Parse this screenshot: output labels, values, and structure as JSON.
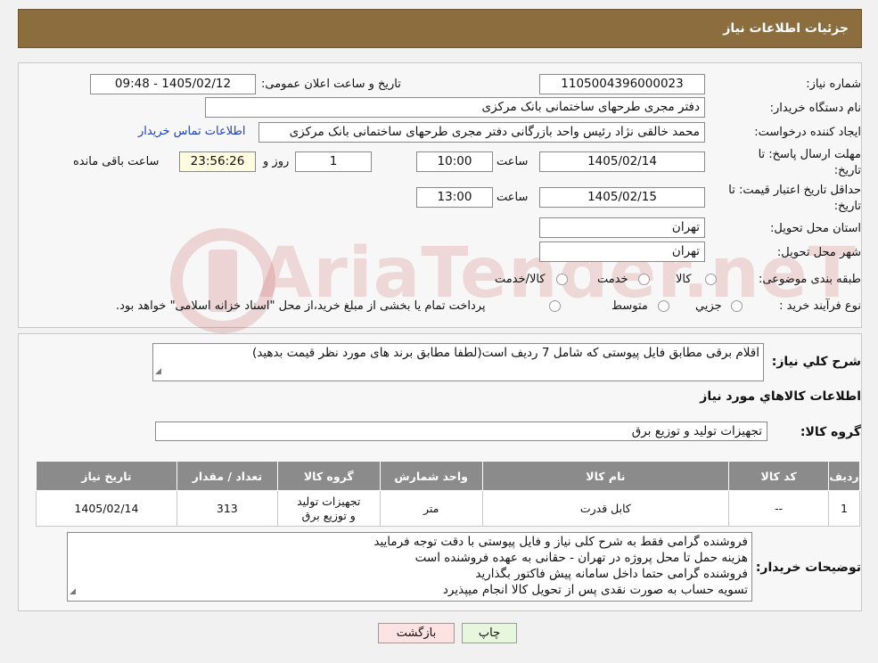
{
  "header": {
    "title": "جزئیات اطلاعات نیاز"
  },
  "watermark": {
    "text": "AriaTender.neT"
  },
  "fields": {
    "need_number_label": "شماره نیاز:",
    "need_number": "1105004396000023",
    "announce_label": "تاریخ و ساعت اعلان عمومی:",
    "announce_value": "1405/02/12 - 09:48",
    "buyer_org_label": "نام دستگاه خریدار:",
    "buyer_org": "دفتر مجری طرحهای ساختمانی بانک مرکزی",
    "requester_label": "ایجاد کننده درخواست:",
    "requester": "محمد خالقی نژاد رئیس واحد بازرگانی دفتر مجری طرحهای ساختمانی بانک مرکزی",
    "contact_link": "اطلاعات تماس خریدار",
    "deadline_label_1": "مهلت ارسال پاسخ: تا",
    "deadline_label_2": "تاریخ:",
    "deadline_date": "1405/02/14",
    "time_label": "ساعت",
    "deadline_time": "10:00",
    "days_value": "1",
    "days_label": "روز و",
    "remaining_value": "23:56:26",
    "remaining_label": "ساعت باقی مانده",
    "validity_label_1": "حداقل تاریخ اعتبار قیمت: تا",
    "validity_label_2": "تاریخ:",
    "validity_date": "1405/02/15",
    "validity_time": "13:00",
    "province_label": "استان محل تحویل:",
    "province": "تهران",
    "city_label": "شهر محل تحویل:",
    "city": "تهران",
    "category_label": "طبقه بندی موضوعی:",
    "category_options": [
      "کالا",
      "خدمت",
      "کالا/خدمت"
    ],
    "process_label": "نوع فرآیند خرید :",
    "process_options": [
      "جزیي",
      "متوسط"
    ],
    "process_note": "پرداخت تمام یا بخشی از مبلغ خرید،از محل \"اسناد خزانه اسلامی\" خواهد بود."
  },
  "description": {
    "label": "شرح کلي نياز:",
    "text": "اقلام برقی مطابق فایل پیوستی که شامل 7 ردیف است(لطفا مطابق برند های مورد نظر قیمت بدهید)"
  },
  "goods_info_title": "اطلاعات کالاهاي مورد نياز",
  "goods_group": {
    "label": "گروه کالا:",
    "value": "تجهیزات تولید و توزیع برق"
  },
  "table": {
    "headers": [
      "رديف",
      "کد کالا",
      "نام کالا",
      "واحد شمارش",
      "گروه کالا",
      "تعداد / مقدار",
      "تاريخ نياز"
    ],
    "rows": [
      [
        "1",
        "--",
        "کابل قدرت",
        "متر",
        "تجهیزات تولید و توزیع برق",
        "313",
        "1405/02/14"
      ]
    ]
  },
  "buyer_notes": {
    "label": "توضيحات خريدار:",
    "lines": [
      "فروشنده گرامی فقط به شرح کلی نیاز و فایل پیوستی با دقت توجه فرمایید",
      "هزینه حمل تا محل پروژه در تهران - حقانی به عهده فروشنده است",
      "فروشنده گرامی حتما داخل سامانه پیش فاکتور بگذارید",
      "تسویه حساب به صورت نقدی پس از تحویل کالا  انجام میپذیرد"
    ]
  },
  "buttons": {
    "print": "چاپ",
    "back": "بازگشت"
  }
}
